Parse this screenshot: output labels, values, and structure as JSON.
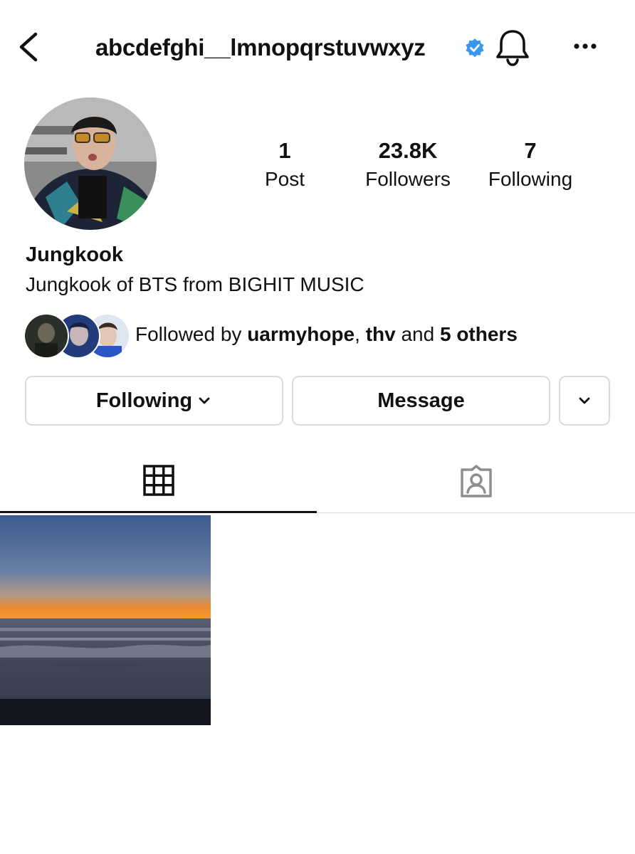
{
  "header": {
    "username": "abcdefghi__lmnopqrstuvwxyz",
    "verified": true,
    "icons": [
      "back-icon",
      "verified-badge-icon",
      "bell-icon",
      "more-icon"
    ]
  },
  "profile": {
    "display_name": "Jungkook",
    "bio": "Jungkook of BTS from BIGHIT MUSIC",
    "stats": {
      "posts": {
        "value": "1",
        "label": "Post"
      },
      "followers": {
        "value": "23.8K",
        "label": "Followers"
      },
      "following": {
        "value": "7",
        "label": "Following"
      }
    }
  },
  "followed_by": {
    "prefix": "Followed by",
    "user1": "uarmyhope",
    "sep": ",",
    "user2": "thv",
    "and": "and",
    "others": "5 others"
  },
  "actions": {
    "following_label": "Following",
    "message_label": "Message"
  },
  "tabs": [
    {
      "icon": "grid-icon",
      "active": true
    },
    {
      "icon": "tagged-icon",
      "active": false
    }
  ],
  "colors": {
    "verified": "#3897f0",
    "border": "#dbdbdb",
    "text": "#111111",
    "tab_inactive": "#8e8e8e"
  }
}
